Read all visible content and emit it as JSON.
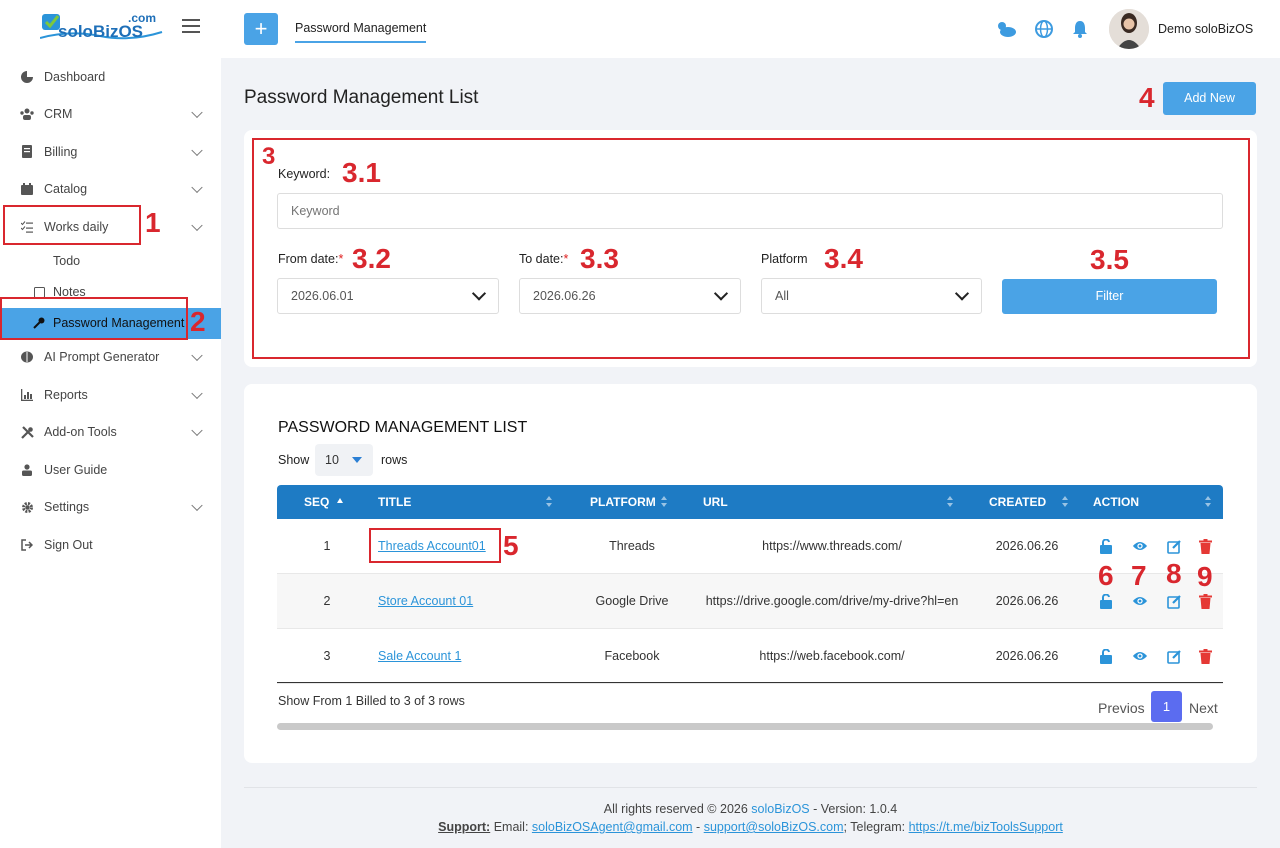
{
  "app": {
    "logo_text": "soloBizOS",
    "logo_suffix": ".com"
  },
  "topbar": {
    "active_tab": "Password Management",
    "user_name": "Demo soloBizOS"
  },
  "sidebar": {
    "items": [
      {
        "label": "Dashboard"
      },
      {
        "label": "CRM"
      },
      {
        "label": "Billing"
      },
      {
        "label": "Catalog"
      },
      {
        "label": "Works daily"
      },
      {
        "label": "Todo"
      },
      {
        "label": "Notes"
      },
      {
        "label": "Password Management"
      },
      {
        "label": "AI Prompt Generator"
      },
      {
        "label": "Reports"
      },
      {
        "label": "Add-on Tools"
      },
      {
        "label": "User Guide"
      },
      {
        "label": "Settings"
      },
      {
        "label": "Sign Out"
      }
    ]
  },
  "page": {
    "title": "Password Management List",
    "add_new_label": "Add New"
  },
  "filter": {
    "keyword_label": "Keyword:",
    "keyword_placeholder": "Keyword",
    "from_label": "From date:",
    "from_value": "2026.06.01",
    "to_label": "To date:",
    "to_value": "2026.06.26",
    "platform_label": "Platform",
    "platform_value": "All",
    "required_mark": "*",
    "button_label": "Filter"
  },
  "list": {
    "heading": "PASSWORD MANAGEMENT LIST",
    "show_label": "Show",
    "rows_value": "10",
    "rows_label": "rows",
    "columns": [
      "SEQ",
      "TITLE",
      "PLATFORM",
      "URL",
      "CREATED",
      "ACTION"
    ],
    "rows": [
      {
        "seq": "1",
        "title": "Threads Account01",
        "platform": "Threads",
        "url": "https://www.threads.com/",
        "created": "2026.06.26"
      },
      {
        "seq": "2",
        "title": "Store Account 01",
        "platform": "Google Drive",
        "url": "https://drive.google.com/drive/my-drive?hl=en",
        "created": "2026.06.26"
      },
      {
        "seq": "3",
        "title": "Sale Account 1",
        "platform": "Facebook",
        "url": "https://web.facebook.com/",
        "created": "2026.06.26"
      }
    ],
    "summary": "Show From 1 Billed to 3 of 3 rows",
    "prev_label": "Previos",
    "current_page": "1",
    "next_label": "Next"
  },
  "footer": {
    "line1_prefix": "All rights reserved © 2026 ",
    "brand": "soloBizOS",
    "line1_suffix": " - Version: 1.0.4",
    "support_label": "Support:",
    "email_label": " Email: ",
    "email1": "soloBizOSAgent@gmail.com",
    "dash": " - ",
    "email2": "support@soloBizOS.com",
    "telegram_label": "; Telegram: ",
    "telegram": "https://t.me/bizToolsSupport"
  },
  "annotations": {
    "a1": "1",
    "a2": "2",
    "a3": "3",
    "a31": "3.1",
    "a32": "3.2",
    "a33": "3.3",
    "a34": "3.4",
    "a35": "3.5",
    "a4": "4",
    "a5": "5",
    "a6": "6",
    "a7": "7",
    "a8": "8",
    "a9": "9"
  },
  "colors": {
    "accent": "#4aa3e6",
    "table_header": "#1e7bc4",
    "annotation": "#d9272e",
    "pager_active": "#5b6cf0"
  }
}
